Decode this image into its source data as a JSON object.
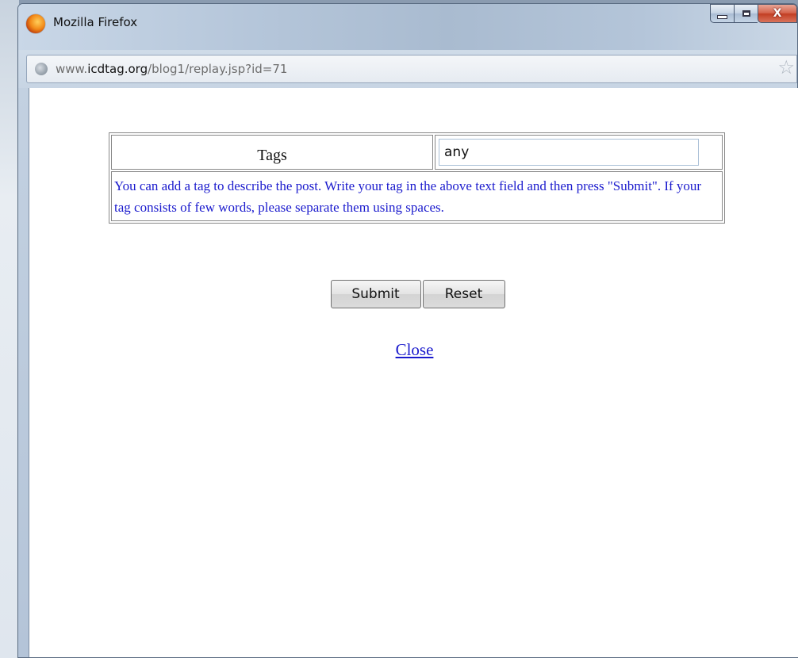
{
  "window": {
    "title": "Mozilla Firefox"
  },
  "urlbar": {
    "url_prefix": "www.",
    "url_host": "icdtag.org",
    "url_path": "/blog1/replay.jsp?id=71"
  },
  "form": {
    "tags_label": "Tags",
    "tag_input_value": "any",
    "help_text": "You can add a tag to describe the post. Write your tag in the above text field and then press \"Submit\". If your tag consists of few words, please separate them using spaces.",
    "submit_label": "Submit",
    "reset_label": "Reset",
    "close_link": "Close"
  },
  "colors": {
    "link_blue": "#1a1acd",
    "close_button_red": "#c23d22"
  },
  "icons": {
    "app": "firefox-icon",
    "site": "globe-icon",
    "bookmark": "star-icon"
  }
}
